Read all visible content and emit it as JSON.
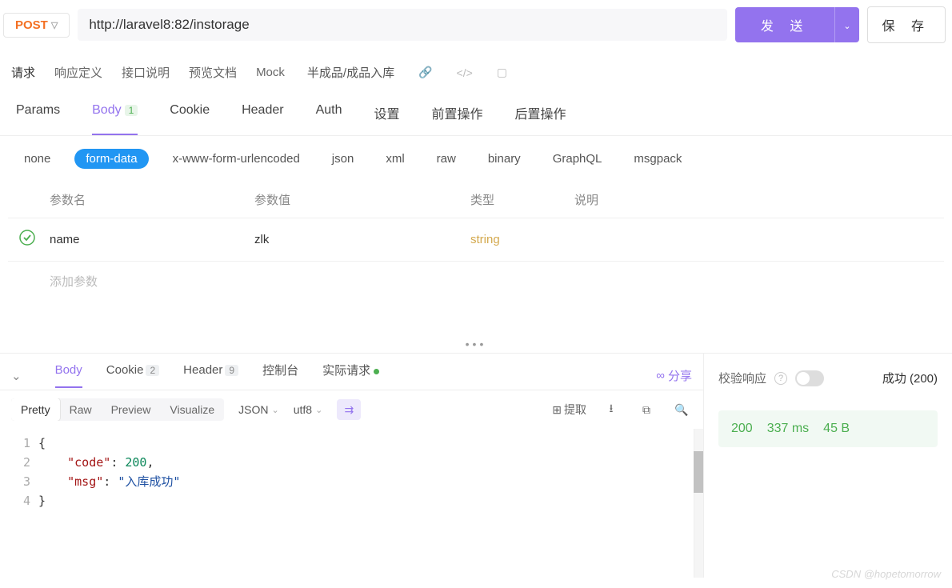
{
  "request": {
    "method": "POST",
    "url": "http://laravel8:82/instorage",
    "send_label": "发 送",
    "save_label": "保 存"
  },
  "sub_tabs": {
    "items": [
      "请求",
      "响应定义",
      "接口说明",
      "预览文档",
      "Mock"
    ],
    "title": "半成品/成品入库"
  },
  "main_tabs": {
    "items": [
      {
        "label": "Params",
        "badge": ""
      },
      {
        "label": "Body",
        "badge": "1"
      },
      {
        "label": "Cookie",
        "badge": ""
      },
      {
        "label": "Header",
        "badge": ""
      },
      {
        "label": "Auth",
        "badge": ""
      },
      {
        "label": "设置",
        "badge": ""
      },
      {
        "label": "前置操作",
        "badge": ""
      },
      {
        "label": "后置操作",
        "badge": ""
      }
    ]
  },
  "body_types": [
    "none",
    "form-data",
    "x-www-form-urlencoded",
    "json",
    "xml",
    "raw",
    "binary",
    "GraphQL",
    "msgpack"
  ],
  "params_table": {
    "headers": {
      "name": "参数名",
      "value": "参数值",
      "type": "类型",
      "desc": "说明"
    },
    "rows": [
      {
        "name": "name",
        "value": "zlk",
        "type": "string",
        "desc": ""
      }
    ],
    "add_placeholder": "添加参数"
  },
  "response": {
    "tabs": [
      {
        "label": "Body",
        "badge": ""
      },
      {
        "label": "Cookie",
        "badge": "2"
      },
      {
        "label": "Header",
        "badge": "9"
      },
      {
        "label": "控制台",
        "badge": ""
      },
      {
        "label": "实际请求",
        "badge": "",
        "dot": true
      }
    ],
    "share_label": "分享",
    "view_modes": [
      "Pretty",
      "Raw",
      "Preview",
      "Visualize"
    ],
    "format": "JSON",
    "encoding": "utf8",
    "extract_label": "提取",
    "json_body": {
      "line1": "{",
      "line2_key": "\"code\"",
      "line2_val": "200",
      "line2_rest": ",",
      "line3_key": "\"msg\"",
      "line3_val": "\"入库成功\"",
      "line4": "}"
    }
  },
  "check_panel": {
    "label": "校验响应",
    "success": "成功 (200)",
    "stats": {
      "status": "200",
      "time": "337 ms",
      "size": "45 B"
    }
  },
  "watermark": "CSDN @hopetomorrow"
}
